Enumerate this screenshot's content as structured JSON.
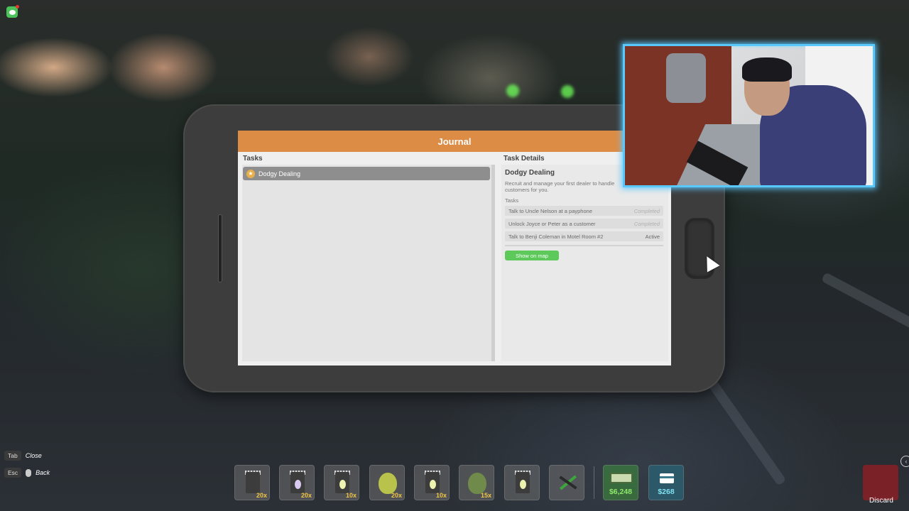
{
  "journal": {
    "title": "Journal",
    "tasks_heading": "Tasks",
    "details_heading": "Task Details",
    "tasks": [
      {
        "label": "Dodgy Dealing",
        "icon": "star-badge-icon",
        "selected": true
      }
    ],
    "details": {
      "title": "Dodgy Dealing",
      "description": "Recruit and manage your first dealer to handle customers for you.",
      "subtasks_heading": "Tasks",
      "subtasks": [
        {
          "label": "Talk to Uncle Nelson at a payphone",
          "status": "Completed"
        },
        {
          "label": "Unlock Joyce or Peter as a customer",
          "status": "Completed"
        },
        {
          "label": "Talk to Benji Coleman in Motel Room #2",
          "status": "Active"
        }
      ],
      "map_button": "Show on map"
    }
  },
  "controls": {
    "tab_key": "Tab",
    "tab_action": "Close",
    "esc_key": "Esc",
    "esc_action": "Back"
  },
  "hotbar": {
    "slots": [
      {
        "icon": "jar-icon",
        "quantity": "20x"
      },
      {
        "icon": "jar-seed-icon",
        "quantity": "20x",
        "color": "#d9c9f0"
      },
      {
        "icon": "jar-seed-icon",
        "quantity": "10x",
        "color": "#eef2b0"
      },
      {
        "icon": "leaf-icon",
        "quantity": "20x",
        "color": "#b9c24a"
      },
      {
        "icon": "jar-seed-icon",
        "quantity": "10x",
        "color": "#eef2b0"
      },
      {
        "icon": "leaf-icon",
        "quantity": "15x",
        "color": "#6f8a4a"
      },
      {
        "icon": "jar-seed-icon",
        "quantity": "",
        "color": "#eef2b0"
      },
      {
        "icon": "trimmers-icon",
        "quantity": ""
      }
    ],
    "cash": "$6,248",
    "bank": "$268",
    "cash_color": "#8fe86a",
    "bank_color": "#7fe0f2",
    "discard_label": "Discard"
  },
  "colors": {
    "header_orange": "#dd8c45",
    "map_button_green": "#5cc95a",
    "webcam_border": "#58c8ff"
  }
}
